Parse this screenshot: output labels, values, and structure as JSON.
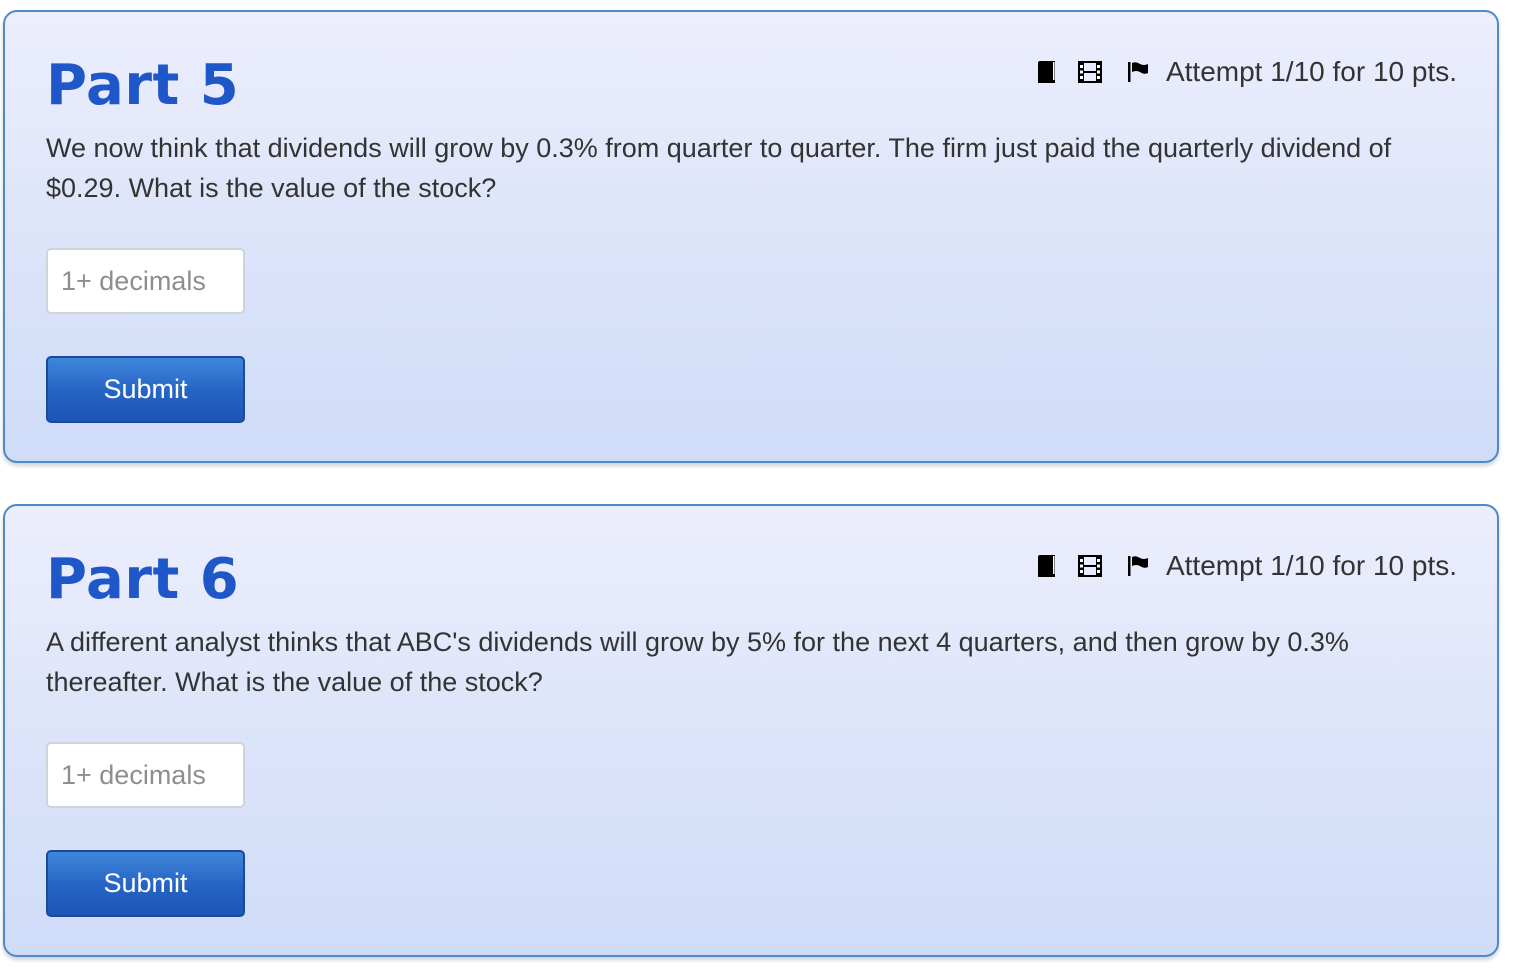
{
  "parts": [
    {
      "title": "Part 5",
      "attempt_text": "Attempt 1/10 for 10 pts.",
      "question": "We now think that dividends will grow by 0.3% from quarter to quarter. The firm just paid the quarterly dividend of $0.29. What is the value of the stock?",
      "input": {
        "value": "",
        "placeholder": "1+ decimals"
      },
      "submit_label": "Submit"
    },
    {
      "title": "Part 6",
      "attempt_text": "Attempt 1/10 for 10 pts.",
      "question": "A different analyst thinks that ABC's dividends will grow by 5% for the next 4 quarters, and then grow by 0.3% thereafter. What is the value of the stock?",
      "input": {
        "value": "",
        "placeholder": "1+ decimals"
      },
      "submit_label": "Submit"
    }
  ],
  "icons": [
    "book-icon",
    "film-icon",
    "flag-icon"
  ],
  "colors": {
    "title": "#1f57c8",
    "card_border": "#4d8ac9",
    "button": "#2563c4",
    "text": "#333333"
  }
}
